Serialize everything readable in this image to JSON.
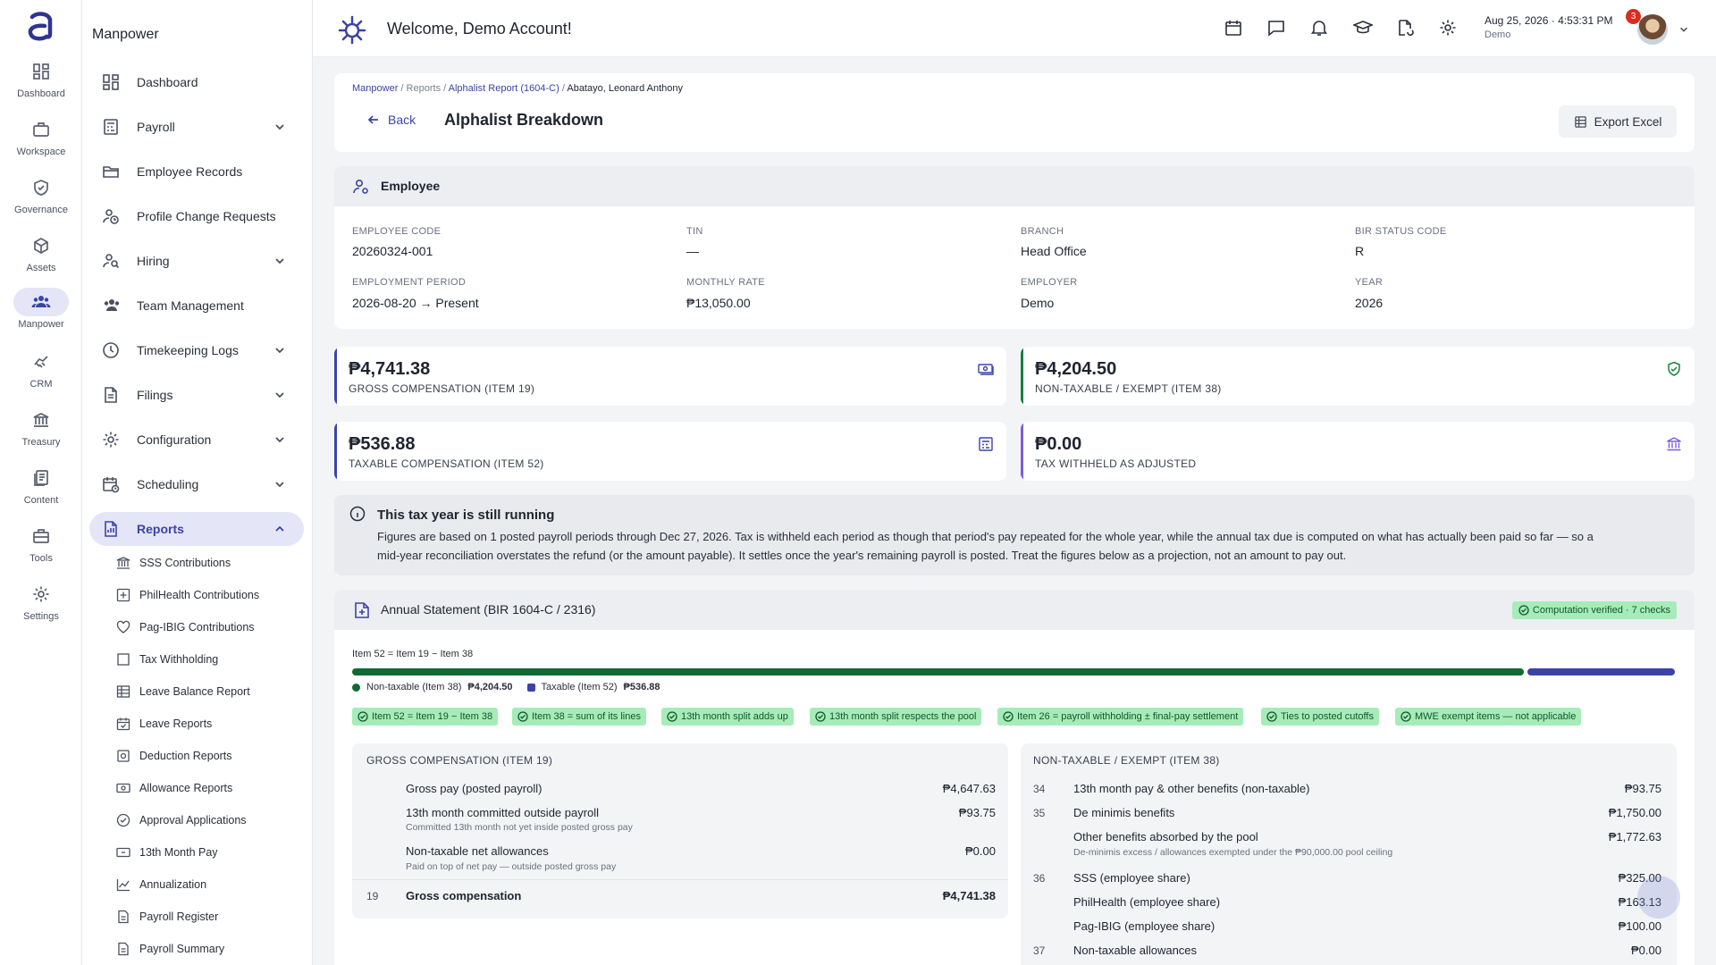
{
  "rail": {
    "items": [
      {
        "label": "Dashboard",
        "icon": "dashboard-icon"
      },
      {
        "label": "Workspace",
        "icon": "briefcase-icon"
      },
      {
        "label": "Governance",
        "icon": "shield-check-icon"
      },
      {
        "label": "Assets",
        "icon": "cube-icon"
      },
      {
        "label": "Manpower",
        "icon": "people-icon"
      },
      {
        "label": "CRM",
        "icon": "handshake-icon"
      },
      {
        "label": "Treasury",
        "icon": "bank-icon"
      },
      {
        "label": "Content",
        "icon": "documents-icon"
      },
      {
        "label": "Tools",
        "icon": "toolbox-icon"
      },
      {
        "label": "Settings",
        "icon": "gear-icon"
      }
    ]
  },
  "sidebar": {
    "title": "Manpower",
    "items": [
      {
        "label": "Dashboard"
      },
      {
        "label": "Payroll"
      },
      {
        "label": "Employee Records"
      },
      {
        "label": "Profile Change Requests"
      },
      {
        "label": "Hiring"
      },
      {
        "label": "Team Management"
      },
      {
        "label": "Timekeeping Logs"
      },
      {
        "label": "Filings"
      },
      {
        "label": "Configuration"
      },
      {
        "label": "Scheduling"
      },
      {
        "label": "Reports"
      }
    ],
    "report_items": [
      {
        "label": "SSS Contributions"
      },
      {
        "label": "PhilHealth Contributions"
      },
      {
        "label": "Pag-IBIG Contributions"
      },
      {
        "label": "Tax Withholding"
      },
      {
        "label": "Leave Balance Report"
      },
      {
        "label": "Leave Reports"
      },
      {
        "label": "Deduction Reports"
      },
      {
        "label": "Allowance Reports"
      },
      {
        "label": "Approval Applications"
      },
      {
        "label": "13th Month Pay"
      },
      {
        "label": "Annualization"
      },
      {
        "label": "Payroll Register"
      },
      {
        "label": "Payroll Summary"
      }
    ]
  },
  "header": {
    "welcome": "Welcome, Demo Account!",
    "notification_count": "3",
    "date": "Aug 25, 2026",
    "time": "4:53:31 PM",
    "account": "Demo"
  },
  "breadcrumb": [
    "Manpower",
    "Reports",
    "Alphalist Report (1604-C)",
    "Abatayo, Leonard Anthony"
  ],
  "page": {
    "back_label": "Back",
    "title": "Alphalist Breakdown",
    "export_label": "Export Excel"
  },
  "employee": {
    "section_title": "Employee",
    "fields": [
      {
        "label": "EMPLOYEE CODE",
        "value": "20260324-001"
      },
      {
        "label": "TIN",
        "value": "—"
      },
      {
        "label": "BRANCH",
        "value": "Head Office"
      },
      {
        "label": "BIR STATUS CODE",
        "value": "R"
      },
      {
        "label": "EMPLOYMENT PERIOD",
        "value": "2026-08-20 → Present"
      },
      {
        "label": "MONTHLY RATE",
        "value": "₱13,050.00"
      },
      {
        "label": "EMPLOYER",
        "value": "Demo"
      },
      {
        "label": "YEAR",
        "value": "2026"
      }
    ]
  },
  "stats": [
    {
      "value": "₱4,741.38",
      "label": "GROSS COMPENSATION (ITEM 19)",
      "color": "#3c43a8",
      "icon": "cash-icon"
    },
    {
      "value": "₱4,204.50",
      "label": "NON-TAXABLE / EXEMPT (ITEM 38)",
      "color": "#15803d",
      "icon": "shield-check-icon"
    },
    {
      "value": "₱536.88",
      "label": "TAXABLE COMPENSATION (ITEM 52)",
      "color": "#3c43a8",
      "icon": "calculator-icon"
    },
    {
      "value": "₱0.00",
      "label": "TAX WITHHELD AS ADJUSTED",
      "color": "#7c5cd6",
      "icon": "bank-icon"
    }
  ],
  "notice": {
    "title": "This tax year is still running",
    "line1": "Figures are based on 1 posted payroll periods through Dec 27, 2026. Tax is withheld each period as though that period's pay repeated for the whole year, while the annual tax due is computed on what has actually been paid so far — so a",
    "line2": "mid-year reconciliation overstates the refund (or the amount payable). It settles once the year's remaining payroll is posted. Treat the figures below as a projection, not an amount to pay out."
  },
  "statement": {
    "title": "Annual Statement (BIR 1604-C / 2316)",
    "verified": "Computation verified · 7 checks",
    "formula": "Item 52 = Item 19 − Item 38",
    "split": {
      "nontaxable_share": 0.887,
      "taxable_share": 0.113,
      "nontaxable_color": "#0f6b34",
      "taxable_color": "#3c43a8"
    },
    "legend": [
      {
        "label": "Non-taxable (Item 38)",
        "value": "₱4,204.50"
      },
      {
        "label": "Taxable (Item 52)",
        "value": "₱536.88"
      }
    ],
    "checks": [
      "Item 52 = Item 19 − Item 38",
      "Item 38 = sum of its lines",
      "13th month split adds up",
      "13th month split respects the pool",
      "Item 26 = payroll withholding ± final-pay settlement",
      "Ties to posted cutoffs",
      "MWE exempt items — not applicable"
    ],
    "gross": {
      "title": "GROSS COMPENSATION (ITEM 19)",
      "lines": [
        {
          "num": "",
          "label": "Gross pay (posted payroll)",
          "sub": "",
          "amount": "₱4,647.63"
        },
        {
          "num": "",
          "label": "13th month committed outside payroll",
          "sub": "Committed 13th month not yet inside posted gross pay",
          "amount": "₱93.75"
        },
        {
          "num": "",
          "label": "Non-taxable net allowances",
          "sub": "Paid on top of net pay — outside posted gross pay",
          "amount": "₱0.00"
        },
        {
          "num": "19",
          "label": "Gross compensation",
          "sub": "",
          "amount": "₱4,741.38"
        }
      ]
    },
    "nontax": {
      "title": "NON-TAXABLE / EXEMPT (ITEM 38)",
      "lines": [
        {
          "num": "34",
          "label": "13th month pay & other benefits (non-taxable)",
          "sub": "",
          "amount": "₱93.75"
        },
        {
          "num": "35",
          "label": "De minimis benefits",
          "sub": "",
          "amount": "₱1,750.00"
        },
        {
          "num": "",
          "label": "Other benefits absorbed by the pool",
          "sub": "De-minimis excess / allowances exempted under the ₱90,000.00 pool ceiling",
          "amount": "₱1,772.63"
        },
        {
          "num": "36",
          "label": "SSS (employee share)",
          "sub": "",
          "amount": "₱325.00"
        },
        {
          "num": "",
          "label": "PhilHealth (employee share)",
          "sub": "",
          "amount": "₱163.13"
        },
        {
          "num": "",
          "label": "Pag-IBIG (employee share)",
          "sub": "",
          "amount": "₱100.00"
        },
        {
          "num": "37",
          "label": "Non-taxable allowances",
          "sub": "",
          "amount": "₱0.00"
        }
      ]
    }
  }
}
